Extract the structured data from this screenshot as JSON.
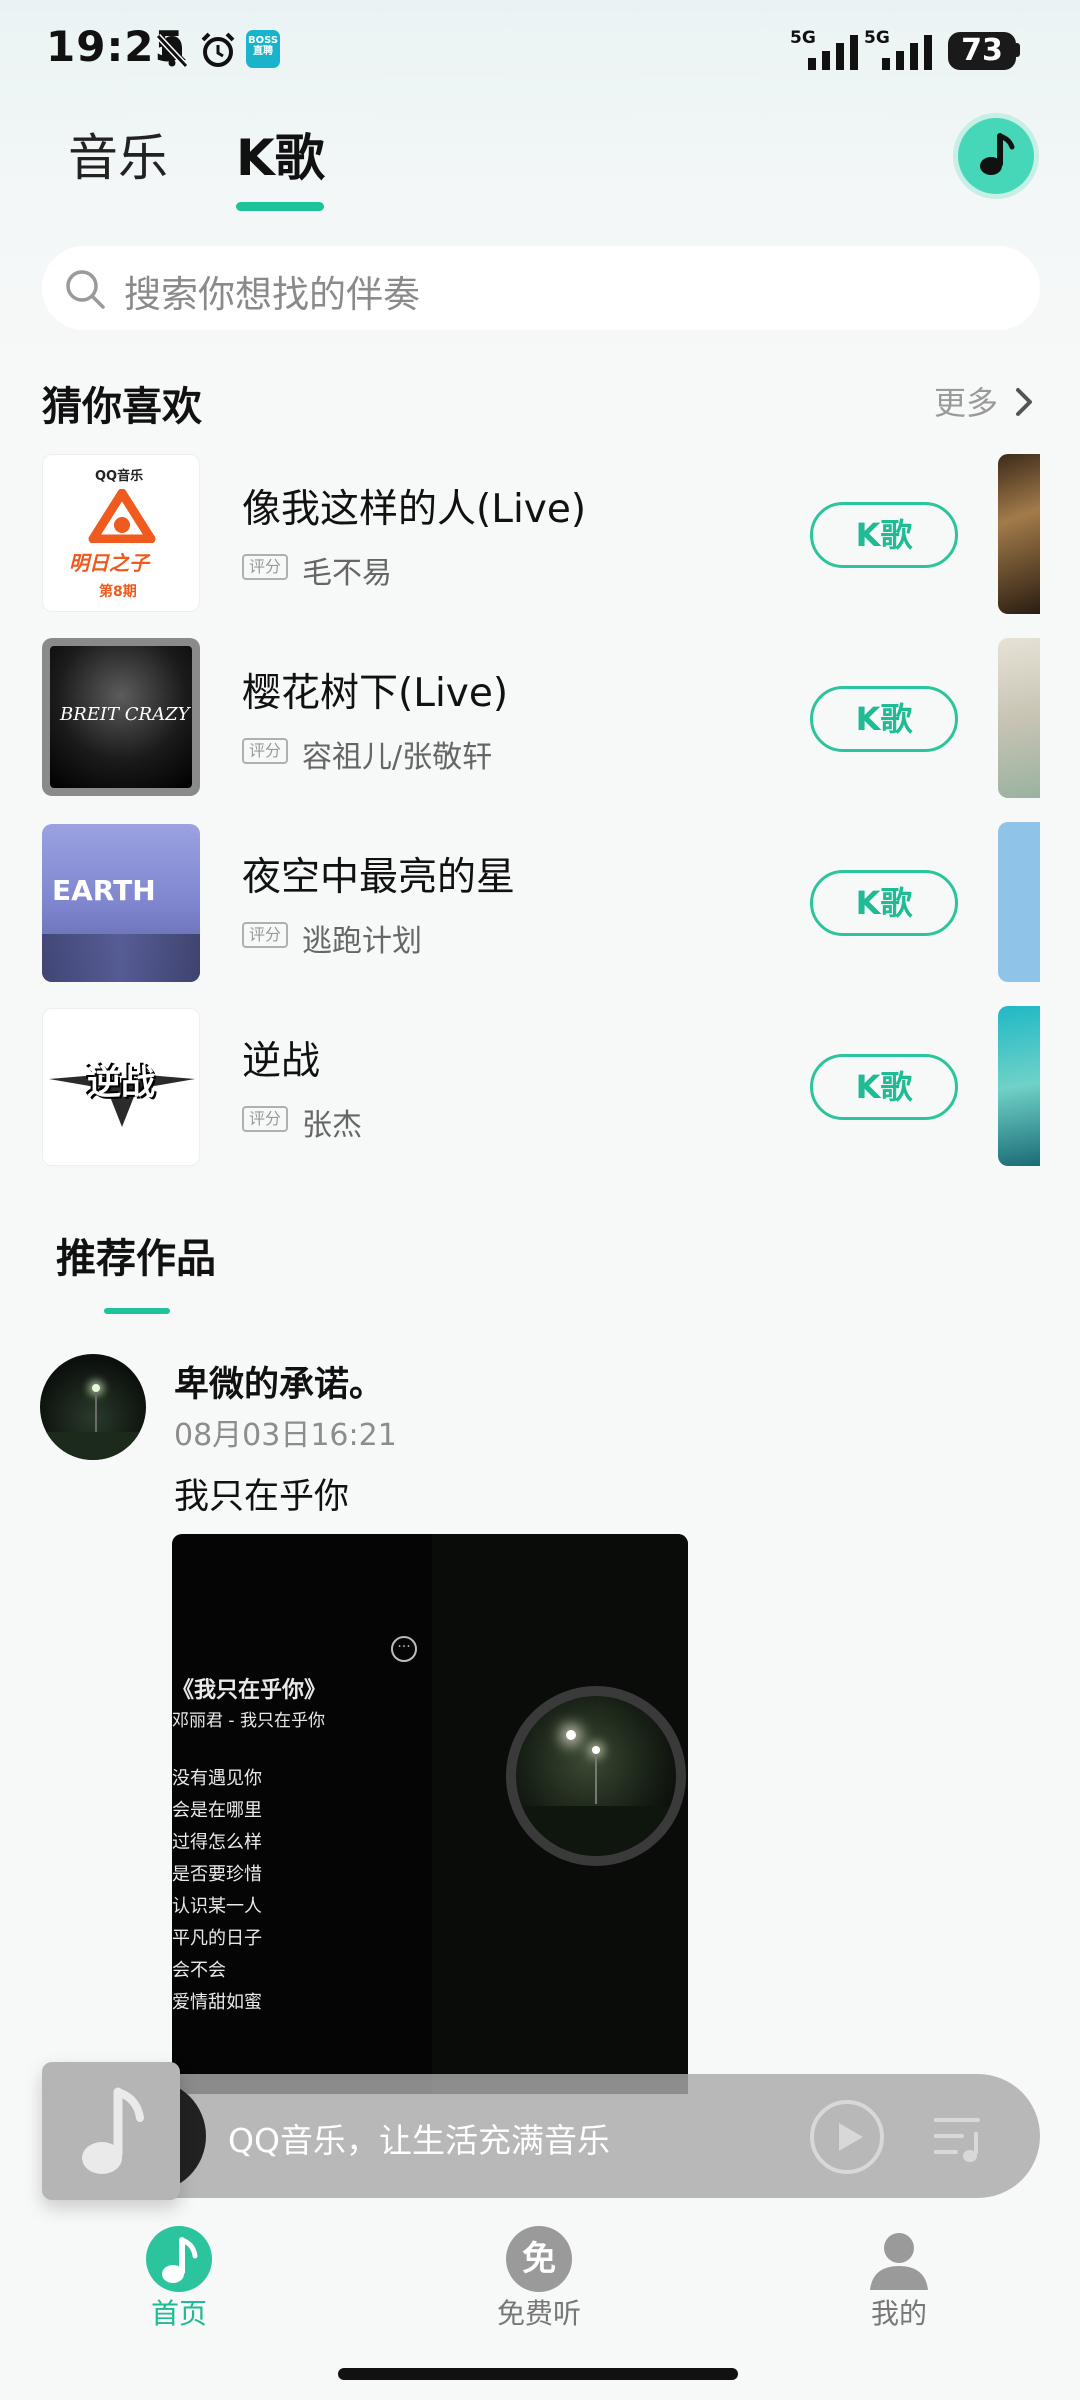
{
  "status_bar": {
    "time": "19:25",
    "boss_label": "BOSS 直聘",
    "signal1_label": "5G",
    "signal2_label": "5G",
    "battery": "73"
  },
  "header": {
    "tabs": [
      {
        "label": "音乐",
        "active": false
      },
      {
        "label": "K歌",
        "active": true
      }
    ],
    "music_icon": "music-note-icon",
    "accent_color": "#1fc39a"
  },
  "search": {
    "placeholder": "搜索你想找的伴奏"
  },
  "guess_you_like": {
    "title": "猜你喜欢",
    "more_label": "更多",
    "songs": [
      {
        "title": "像我这样的人(Live)",
        "rating_tag": "评分",
        "artist": "毛不易",
        "button": "K歌",
        "cover_brand": "QQ音乐",
        "cover_text": "明日之子",
        "cover_issue": "第8期"
      },
      {
        "title": "樱花树下(Live)",
        "rating_tag": "评分",
        "artist": "容祖儿/张敬轩",
        "button": "K歌",
        "cover_text": "BREIT CRAZY"
      },
      {
        "title": "夜空中最亮的星",
        "rating_tag": "评分",
        "artist": "逃跑计划",
        "button": "K歌",
        "cover_text": "EARTH"
      },
      {
        "title": "逆战",
        "rating_tag": "评分",
        "artist": "张杰",
        "button": "K歌",
        "cover_text": "逆战"
      }
    ]
  },
  "recommend": {
    "title": "推荐作品",
    "post": {
      "user": "卑微的承诺。",
      "time": "08月03日16:21",
      "text": "我只在乎你",
      "video_title": "《我只在乎你》",
      "video_subtitle": "邓丽君 - 我只在乎你",
      "video_lyrics": [
        "没有遇见你",
        "会是在哪里",
        "过得怎么样",
        "是否要珍惜",
        "认识某一人",
        "平凡的日子",
        "会不会",
        "爱情甜如蜜"
      ]
    }
  },
  "mini_player": {
    "text": "QQ音乐，让生活充满音乐"
  },
  "bottom_nav": {
    "items": [
      {
        "label": "首页",
        "active": true,
        "icon": "home-music-icon"
      },
      {
        "label": "免费听",
        "active": false,
        "icon": "free-listen-icon",
        "icon_text": "免"
      },
      {
        "label": "我的",
        "active": false,
        "icon": "profile-icon"
      }
    ]
  }
}
